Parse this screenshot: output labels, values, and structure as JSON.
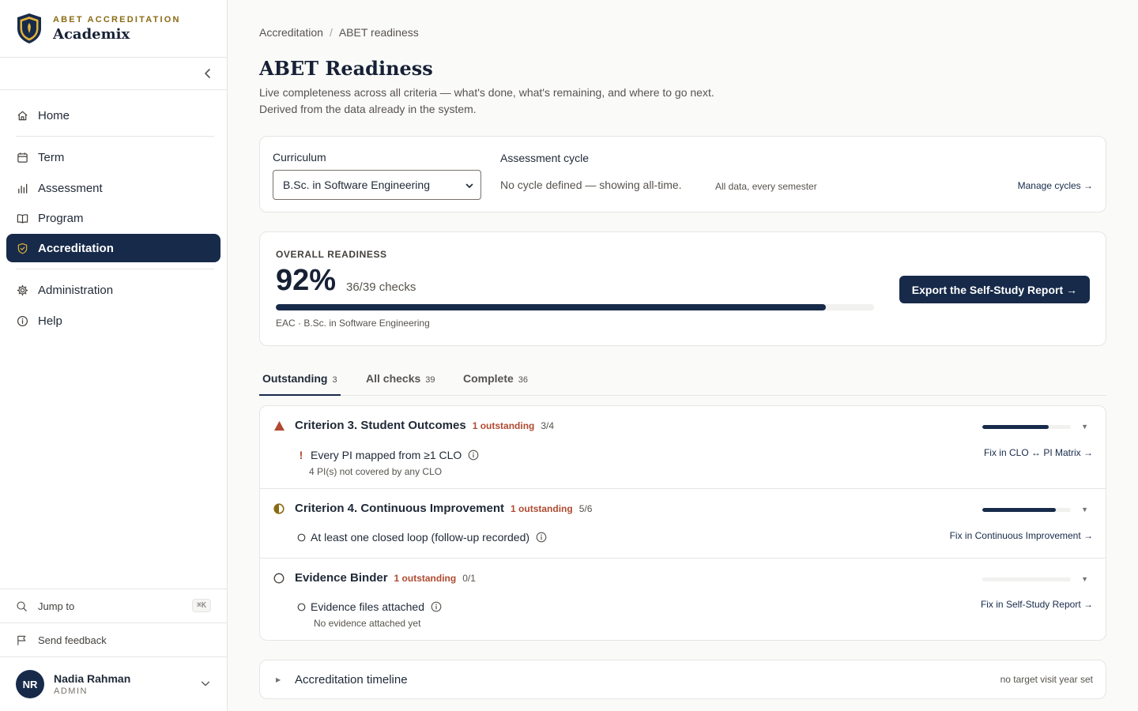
{
  "brand": {
    "kicker": "ABET ACCREDITATION",
    "name": "Academix"
  },
  "sidebar": {
    "items": [
      {
        "label": "Home",
        "icon": "home-icon"
      },
      {
        "label": "Term",
        "icon": "calendar-icon"
      },
      {
        "label": "Assessment",
        "icon": "bar-chart-icon"
      },
      {
        "label": "Program",
        "icon": "book-icon"
      },
      {
        "label": "Accreditation",
        "icon": "shield-icon",
        "active": true
      },
      {
        "label": "Administration",
        "icon": "gear-icon"
      },
      {
        "label": "Help",
        "icon": "info-icon"
      }
    ],
    "jump_to": "Jump to",
    "jump_shortcut": "⌘K",
    "send_feedback": "Send feedback",
    "user": {
      "initials": "NR",
      "name": "Nadia Rahman",
      "role": "ADMIN"
    }
  },
  "breadcrumb": {
    "parent": "Accreditation",
    "separator": "/",
    "current": "ABET readiness"
  },
  "page": {
    "title": "ABET Readiness",
    "subtitle": "Live completeness across all criteria — what's done, what's remaining, and where to go next. Derived from the data already in the system."
  },
  "filters": {
    "curriculum_label": "Curriculum",
    "curriculum_value": "B.Sc. in Software Engineering",
    "cycle_label": "Assessment cycle",
    "cycle_text": "No cycle defined — showing all-time.",
    "cycle_note": "All data, every semester",
    "manage_link": "Manage cycles →"
  },
  "readiness": {
    "overline": "OVERALL READINESS",
    "percent": "92%",
    "checks": "36/39 checks",
    "progress_fraction": 0.92,
    "meta": "EAC · B.Sc. in Software Engineering",
    "export_label": "Export the Self-Study Report →"
  },
  "tabs": [
    {
      "label": "Outstanding",
      "count": "3",
      "active": true
    },
    {
      "label": "All checks",
      "count": "39"
    },
    {
      "label": "Complete",
      "count": "36"
    }
  ],
  "criteria": [
    {
      "title": "Criterion 3. Student Outcomes",
      "outstanding": "1 outstanding",
      "fraction": "3/4",
      "progress_fraction": 0.75,
      "status_icon": "warning-triangle-icon",
      "check": {
        "text": "Every PI mapped from ≥1 CLO",
        "note": "4 PI(s) not covered by any CLO",
        "marker": "!",
        "fix": "Fix in CLO ↔ PI Matrix →"
      }
    },
    {
      "title": "Criterion 4. Continuous Improvement",
      "outstanding": "1 outstanding",
      "fraction": "5/6",
      "progress_fraction": 0.83,
      "status_icon": "half-circle-icon",
      "check": {
        "text": "At least one closed loop (follow-up recorded)",
        "note": "",
        "marker": "○",
        "fix": "Fix in Continuous Improvement →"
      }
    },
    {
      "title": "Evidence Binder",
      "outstanding": "1 outstanding",
      "fraction": "0/1",
      "progress_fraction": 0,
      "status_icon": "empty-circle-icon",
      "check": {
        "text": "Evidence files attached",
        "note": "No evidence attached yet",
        "marker": "○",
        "fix": "Fix in Self-Study Report →"
      }
    }
  ],
  "timeline": {
    "title": "Accreditation timeline",
    "note": "no target visit year set"
  },
  "colors": {
    "navy": "#172a4a",
    "gold": "#8a6a12",
    "danger": "#b04a31",
    "half": "#8a6a12"
  }
}
